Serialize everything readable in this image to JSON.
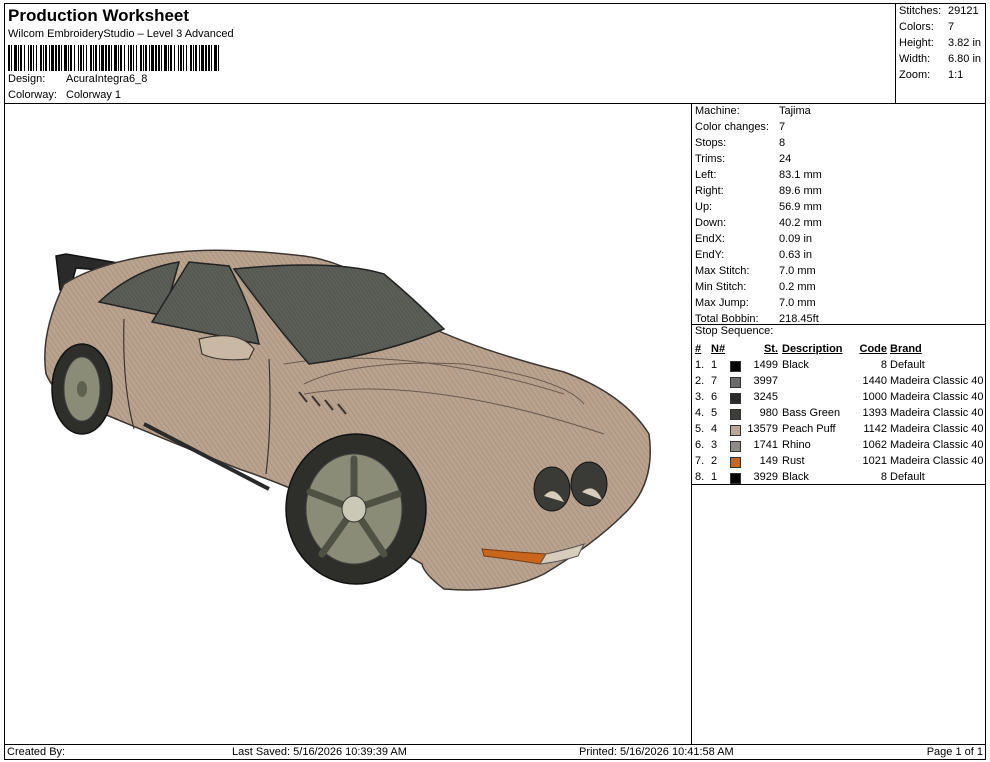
{
  "header": {
    "title": "Production Worksheet",
    "software": "Wilcom EmbroideryStudio – Level 3 Advanced",
    "design_label": "Design:",
    "design_value": "AcuraIntegra6_8",
    "colorway_label": "Colorway:",
    "colorway_value": "Colorway 1"
  },
  "summary": [
    {
      "label": "Stitches:",
      "value": "29121"
    },
    {
      "label": "Colors:",
      "value": "7"
    },
    {
      "label": "Height:",
      "value": "3.82 in"
    },
    {
      "label": "Width:",
      "value": "6.80 in"
    },
    {
      "label": "Zoom:",
      "value": "1:1"
    }
  ],
  "machine_info": [
    {
      "label": "Machine:",
      "value": "Tajima"
    },
    {
      "label": "Color changes:",
      "value": "7"
    },
    {
      "label": "Stops:",
      "value": "8"
    },
    {
      "label": "Trims:",
      "value": "24"
    },
    {
      "label": "Left:",
      "value": "83.1 mm"
    },
    {
      "label": "Right:",
      "value": "89.6 mm"
    },
    {
      "label": "Up:",
      "value": "56.9 mm"
    },
    {
      "label": "Down:",
      "value": "40.2 mm"
    },
    {
      "label": "EndX:",
      "value": "0.09 in"
    },
    {
      "label": "EndY:",
      "value": "0.63 in"
    },
    {
      "label": "Max Stitch:",
      "value": "7.0 mm"
    },
    {
      "label": "Min Stitch:",
      "value": "0.2 mm"
    },
    {
      "label": "Max Jump:",
      "value": "7.0 mm"
    },
    {
      "label": "Total Bobbin:",
      "value": "218.45ft"
    }
  ],
  "stop_sequence": {
    "label": "Stop Sequence:",
    "headers": {
      "num": "#",
      "n": "N#",
      "st": "St.",
      "desc": "Description",
      "code": "Code",
      "brand": "Brand"
    },
    "rows": [
      {
        "num": "1.",
        "n": "1",
        "color": "#000000",
        "st": "1499",
        "desc": "Black",
        "code": "8",
        "brand": "Default"
      },
      {
        "num": "2.",
        "n": "7",
        "color": "#6b6b6b",
        "st": "3997",
        "desc": "",
        "code": "1440",
        "brand": "Madeira Classic 40"
      },
      {
        "num": "3.",
        "n": "6",
        "color": "#2b2b2b",
        "st": "3245",
        "desc": "",
        "code": "1000",
        "brand": "Madeira Classic 40"
      },
      {
        "num": "4.",
        "n": "5",
        "color": "#3d3d3a",
        "st": "980",
        "desc": "Bass Green",
        "code": "1393",
        "brand": "Madeira Classic 40"
      },
      {
        "num": "5.",
        "n": "4",
        "color": "#b9a89a",
        "st": "13579",
        "desc": "Peach Puff",
        "code": "1142",
        "brand": "Madeira Classic 40"
      },
      {
        "num": "6.",
        "n": "3",
        "color": "#8e8a85",
        "st": "1741",
        "desc": "Rhino",
        "code": "1062",
        "brand": "Madeira Classic 40"
      },
      {
        "num": "7.",
        "n": "2",
        "color": "#c8661c",
        "st": "149",
        "desc": "Rust",
        "code": "1021",
        "brand": "Madeira Classic 40"
      },
      {
        "num": "8.",
        "n": "1",
        "color": "#000000",
        "st": "3929",
        "desc": "Black",
        "code": "8",
        "brand": "Default"
      }
    ]
  },
  "footer": {
    "created_by": "Created By:",
    "last_saved": "Last Saved: 5/16/2026 10:39:39 AM",
    "printed": "Printed: 5/16/2026 10:41:58 AM",
    "page": "Page 1 of 1"
  },
  "design_image": {
    "subject": "car-embroidery",
    "body_color": "#b9a38f",
    "glass_color": "#5c5f58",
    "tire_color": "#2e2f2b",
    "rim_color": "#8a8c78",
    "light_color": "#c8661c"
  }
}
